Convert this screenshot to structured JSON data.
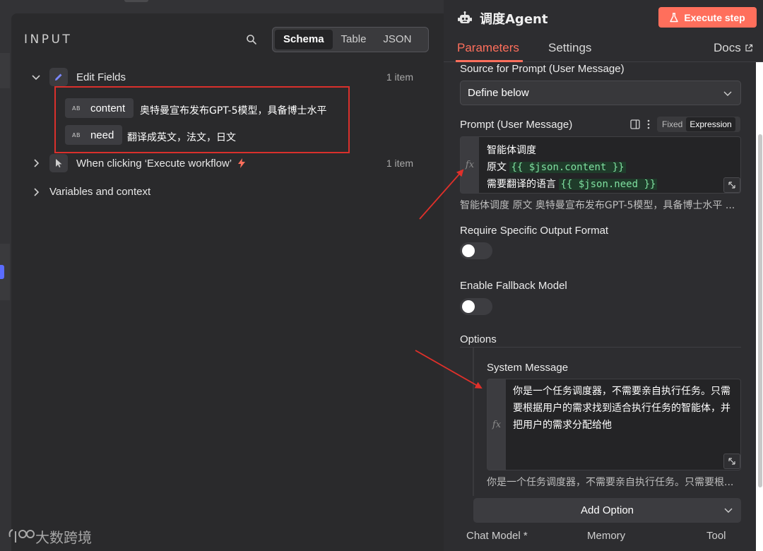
{
  "input_panel": {
    "title": "INPUT",
    "view_tabs": [
      "Schema",
      "Table",
      "JSON"
    ],
    "active_view": "Schema",
    "tree": [
      {
        "label": "Edit Fields",
        "count": "1 item",
        "expanded": true,
        "icon": "pencil-icon"
      },
      {
        "label": "When clicking ‘Execute workflow’",
        "count": "1 item",
        "expanded": false,
        "icon": "cursor-icon"
      },
      {
        "label": "Variables and context",
        "expanded": false
      }
    ],
    "fields": [
      {
        "type_badge": "AB",
        "name": "content",
        "value": "奥特曼宣布发布GPT-5模型，具备博士水平"
      },
      {
        "type_badge": "AB",
        "name": "need",
        "value": "翻译成英文，法文，日文"
      }
    ]
  },
  "watermark": {
    "text": "大数跨境"
  },
  "node_panel": {
    "title": "调度Agent",
    "execute_label": "Execute step",
    "tabs": [
      "Parameters",
      "Settings"
    ],
    "active_tab": "Parameters",
    "docs_label": "Docs",
    "source_label": "Source for Prompt (User Message)",
    "source_value": "Define below",
    "prompt_label": "Prompt (User Message)",
    "mode_fixed": "Fixed",
    "mode_expression": "Expression",
    "prompt_lines": {
      "l1": "智能体调度",
      "l2_prefix": "原文 ",
      "l2_token": "{{ $json.content }}",
      "l3_prefix": "需要翻译的语言 ",
      "l3_token": "{{ $json.need }}"
    },
    "prompt_preview": "智能体调度 原文 奥特曼宣布发布GPT-5模型，具备博士水平 ...",
    "require_format_label": "Require Specific Output Format",
    "require_format_on": false,
    "fallback_label": "Enable Fallback Model",
    "fallback_on": false,
    "options_label": "Options",
    "system_message_label": "System Message",
    "system_message": "你是一个任务调度器，不需要亲自执行任务。只需要根据用户的需求找到适合执行任务的智能体，并把用户的需求分配给他",
    "system_preview": "你是一个任务调度器，不需要亲自执行任务。只需要根...",
    "add_option_label": "Add Option",
    "bottom_labels": [
      "Chat Model *",
      "Memory",
      "Tool"
    ]
  },
  "colors": {
    "accent": "#ff6f5c",
    "highlight_box": "#d9302c",
    "expr_token": "#7fe0a0"
  }
}
